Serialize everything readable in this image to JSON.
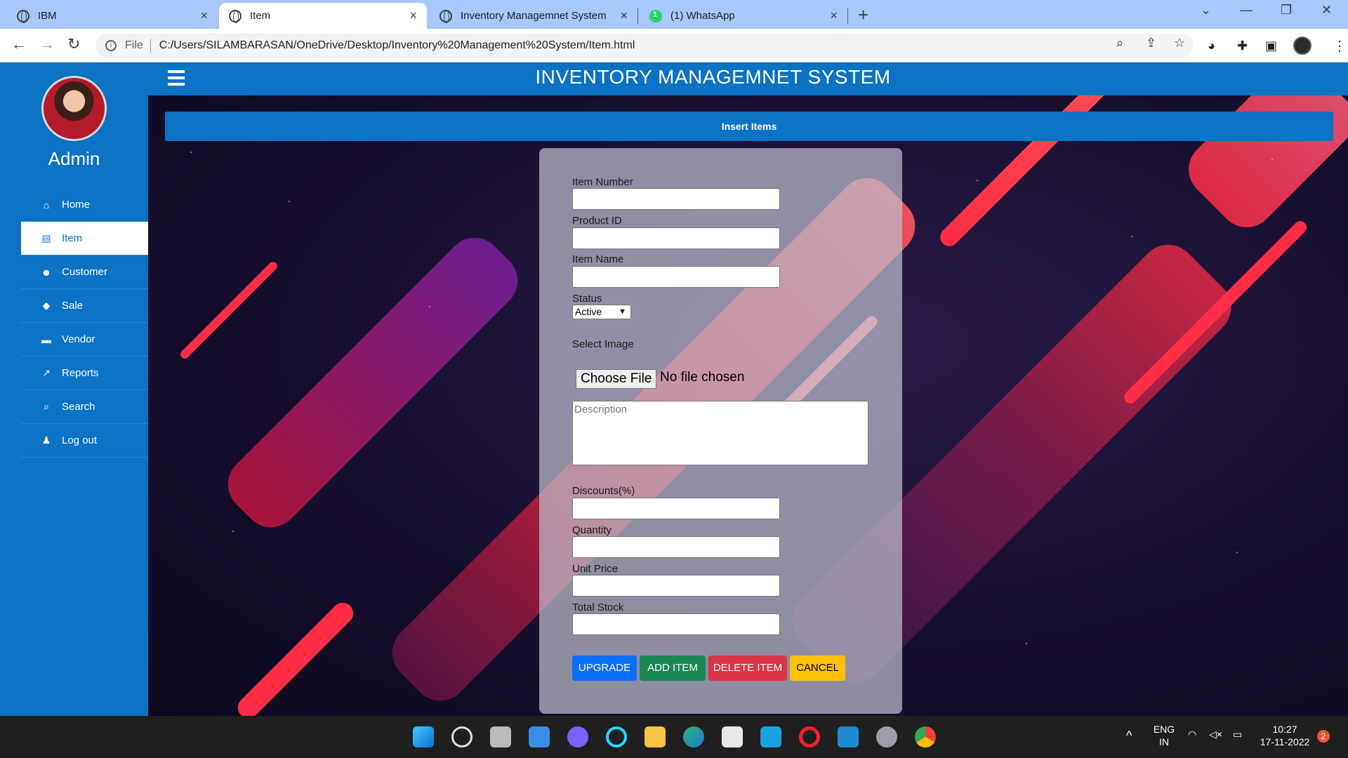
{
  "browser": {
    "tabs": [
      {
        "title": "IBM",
        "icon": "globe-icon"
      },
      {
        "title": "Item",
        "icon": "globe-icon",
        "active": true
      },
      {
        "title": "Inventory Managemnet System",
        "icon": "globe-icon"
      },
      {
        "title": "(1) WhatsApp",
        "icon": "whatsapp-icon"
      }
    ],
    "close_glyph": "×",
    "new_tab_glyph": "+",
    "address_prefix": "File",
    "url": "C:/Users/SILAMBARASAN/OneDrive/Desktop/Inventory%20Management%20System/Item.html"
  },
  "app": {
    "title": "INVENTORY MANAGEMNET SYSTEM",
    "user": "Admin",
    "nav": [
      {
        "label": "Home",
        "icon": "home-icon",
        "glyph": "⌂"
      },
      {
        "label": "Item",
        "icon": "shop-icon",
        "glyph": "▤",
        "active": true
      },
      {
        "label": "Customer",
        "icon": "users-icon",
        "glyph": "☻"
      },
      {
        "label": "Sale",
        "icon": "tag-icon",
        "glyph": "◆"
      },
      {
        "label": "Vendor",
        "icon": "briefcase-icon",
        "glyph": "▬"
      },
      {
        "label": "Reports",
        "icon": "chart-icon",
        "glyph": "↗"
      },
      {
        "label": "Search",
        "icon": "search-icon",
        "glyph": "⌕"
      },
      {
        "label": "Log out",
        "icon": "user-icon",
        "glyph": "♟"
      }
    ]
  },
  "form": {
    "header": "Insert Items",
    "item_number_label": "Item Number",
    "product_id_label": "Product ID",
    "item_name_label": "Item Name",
    "status_label": "Status",
    "status_value": "Active",
    "select_image_label": "Select Image",
    "choose_file": "Choose File",
    "no_file": "No file chosen",
    "description_placeholder": "Description",
    "discounts_label": "Discounts(%)",
    "quantity_label": "Quantity",
    "unit_price_label": "Unit Price",
    "total_stock_label": "Total Stock",
    "buttons": {
      "upgrade": "UPGRADE",
      "add": "ADD ITEM",
      "delete": "DELETE ITEM",
      "cancel": "CANCEL"
    },
    "button_colors": {
      "upgrade": "#0d6efd",
      "add": "#198754",
      "delete": "#dc3545",
      "cancel": "#ffc107"
    }
  },
  "taskbar": {
    "lang_line1": "ENG",
    "lang_line2": "IN",
    "time": "10:27",
    "date": "17-11-2022",
    "notification_count": "2"
  }
}
